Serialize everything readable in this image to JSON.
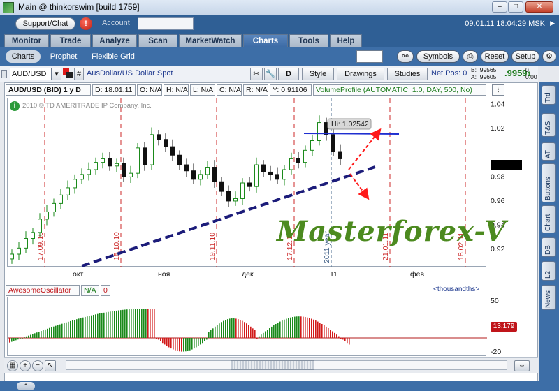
{
  "window": {
    "title": "Main @ thinkorswim [build 1759]",
    "minimize": "–",
    "maximize": "□",
    "close": "✕"
  },
  "topbar": {
    "support_chat": "Support/Chat",
    "alert_badge": "!",
    "account_label": "Account",
    "account_value": "",
    "datetime": "09.01.11 18:04:29 MSK",
    "datetime_menu": "▶"
  },
  "tabs": [
    "Monitor",
    "Trade",
    "Analyze",
    "Scan",
    "MarketWatch",
    "Charts",
    "Tools",
    "Help"
  ],
  "active_tab": "Charts",
  "subtabs": [
    "Charts",
    "Prophet",
    "Flexible Grid"
  ],
  "toolbar": {
    "symbols": "Symbols",
    "reset": "Reset",
    "setup": "Setup"
  },
  "symbolbar": {
    "symbol": "AUD/USD",
    "description": "AusDollar/US Dollar Spot",
    "aggregation": "D",
    "style": "Style",
    "drawings": "Drawings",
    "studies": "Studies",
    "netpos": "Net Pos: 0",
    "bid_label": "B:",
    "bid": ".99565",
    "ask_label": "A:",
    "ask": ".99605",
    "last": ".9959",
    "last_suffix": "1",
    "pct_top": "0",
    "pct_bottom": "0.00 %"
  },
  "header": {
    "cells": [
      "AUD/USD (BID) 1 y D",
      "D: 18.01.11",
      "O: N/A",
      "H: N/A",
      "L: N/A",
      "C: N/A",
      "R: N/A",
      "Y: 0.91106",
      "VolumeProfile (AUTOMATIC, 1.0, DAY, 500, No)"
    ]
  },
  "copyright": "2010 © TD AMERITRADE IP Company, Inc.",
  "watermark_text": "Masterforex-V",
  "tooltip_hi": "Hi: 1.02542",
  "oscillator": {
    "name": "AwesomeOscillator",
    "value": "N/A",
    "zero": "0",
    "units": "<thousandths>",
    "badge": "13.179",
    "axis_top": "50",
    "axis_bottom": "-20"
  },
  "side_tabs": [
    "Trd",
    "T&S",
    "AT",
    "Buttons",
    "Chart",
    "DB",
    "L2",
    "News"
  ],
  "chart_data": {
    "type": "candlestick",
    "y_axis": {
      "ticks": [
        "1.04",
        "1.02",
        "0.98",
        "0.96",
        "0.94",
        "0.92"
      ],
      "range": [
        0.905,
        1.045
      ]
    },
    "x_axis": {
      "ticks": [
        "окт",
        "ноя",
        "дек",
        "11",
        "фев"
      ]
    },
    "vertical_markers": [
      "17.09.10",
      "15.10.10",
      "19.11.10",
      "17.12.10",
      "2011 year",
      "21.01.11",
      "18.02.11"
    ],
    "approx_daily_closes": [
      0.916,
      0.921,
      0.929,
      0.934,
      0.945,
      0.951,
      0.958,
      0.965,
      0.971,
      0.978,
      0.982,
      0.986,
      0.992,
      0.995,
      0.989,
      0.991,
      0.98,
      0.983,
      1.004,
      0.99,
      1.015,
      1.011,
      1.005,
      0.998,
      0.99,
      0.985,
      0.978,
      0.982,
      0.988,
      0.976,
      0.968,
      0.96,
      0.962,
      0.975,
      0.972,
      0.99,
      0.984,
      0.982,
      0.978,
      0.986,
      0.995,
      0.992,
      1.002,
      1.01,
      1.025,
      1.015,
      1.001,
      0.995
    ]
  },
  "colors": {
    "up": "#1a8a1a",
    "down": "#111111",
    "trend_blue": "#1c1c7a",
    "resistance": "#1f2fd0",
    "arrow": "#ff1a1a",
    "marker": "#cc2a2a",
    "watermark": "#4c8a1f"
  }
}
